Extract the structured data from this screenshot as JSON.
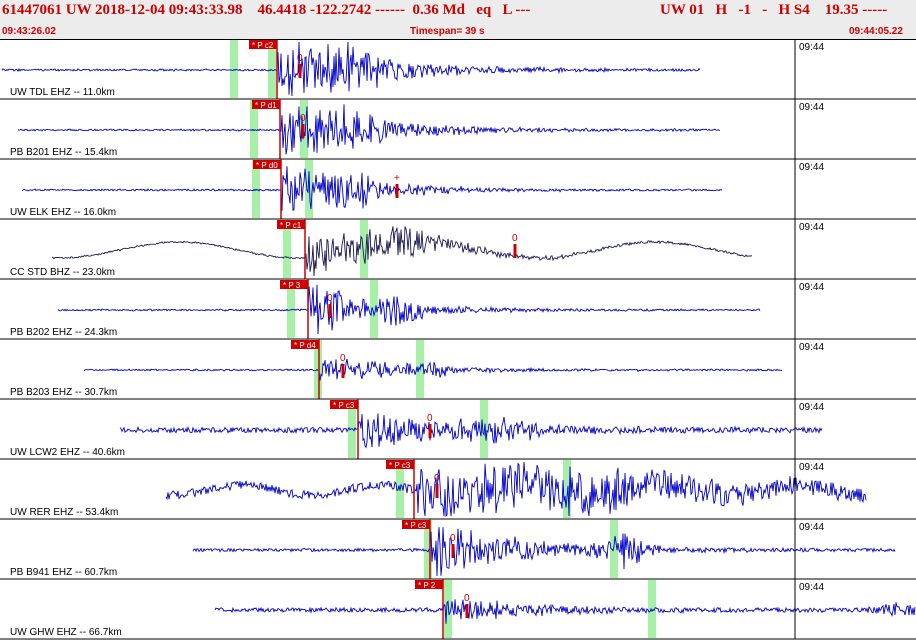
{
  "header": {
    "event_line": "61447061 UW 2018-12-04 09:43:33.98    46.4418 -122.2742 ------  0.36 Md   eq   L ---",
    "right_line": "UW 01   H   -1   -   H S4    19.35 -----",
    "start_time": "09:43:26.02",
    "timespan": "Timespan=  39 s",
    "end_time": "09:44:05.22"
  },
  "colors": {
    "trace": "#0000cc",
    "trace_dark": "#1a1a55",
    "pick": "#cc0000",
    "window": "#a8f0a8",
    "header_text": "#cc0000"
  },
  "traces": [
    {
      "label": "UW TDL EHZ -- 11.0km",
      "tick": "09:44",
      "pick_label": "P c2",
      "amp_label": "0",
      "trace_color": "blue"
    },
    {
      "label": "PB B201 EHZ -- 15.4km",
      "tick": "09:44",
      "pick_label": "P d1",
      "amp_label": "0",
      "trace_color": "blue"
    },
    {
      "label": "UW ELK EHZ -- 16.0km",
      "tick": "09:44",
      "pick_label": "P d0",
      "amp_label": "+",
      "trace_color": "blue"
    },
    {
      "label": "CC STD BHZ -- 23.0km",
      "tick": "09:44",
      "pick_label": "P c1",
      "amp_label": "0",
      "trace_color": "dark"
    },
    {
      "label": "PB B202 EHZ -- 24.3km",
      "tick": "09:44",
      "pick_label": "P 3",
      "amp_label": "0",
      "trace_color": "blue"
    },
    {
      "label": "PB B203 EHZ -- 30.7km",
      "tick": "09:44",
      "pick_label": "P d4",
      "amp_label": "0",
      "trace_color": "blue"
    },
    {
      "label": "UW LCW2 EHZ -- 40.6km",
      "tick": "09:44",
      "pick_label": "P c3",
      "amp_label": "0",
      "trace_color": "blue"
    },
    {
      "label": "UW RER EHZ -- 53.4km",
      "tick": "09:44",
      "pick_label": "P c3",
      "amp_label": "0",
      "trace_color": "blue"
    },
    {
      "label": "PB B941 EHZ -- 60.7km",
      "tick": "09:44",
      "pick_label": "P c3",
      "amp_label": "0",
      "trace_color": "blue"
    },
    {
      "label": "UW GHW EHZ -- 66.7km",
      "tick": "09:44",
      "pick_label": "P 2",
      "amp_label": "0",
      "trace_color": "blue"
    }
  ]
}
